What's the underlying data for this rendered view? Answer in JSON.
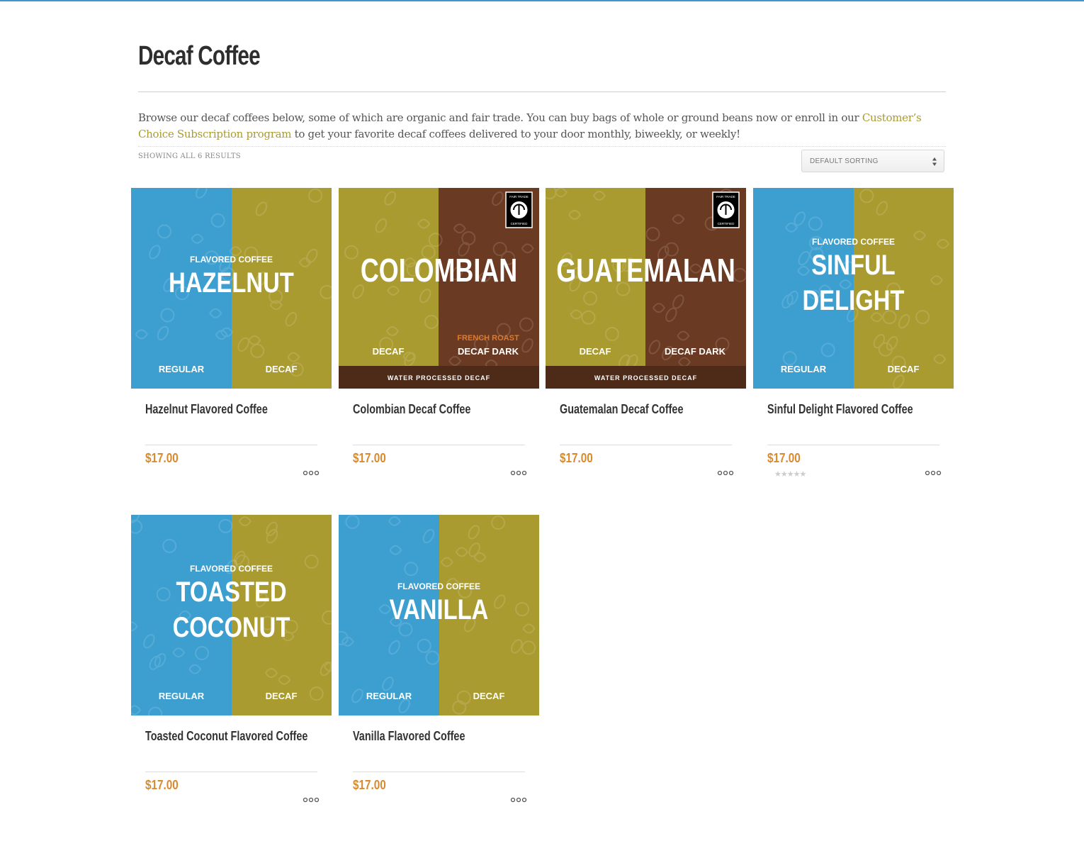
{
  "page": {
    "title": "Decaf Coffee",
    "description_before": "Browse our decaf coffees below, some of which are organic and fair trade. You can buy bags of whole or ground beans now or enroll in our ",
    "description_link": "Customer’s Choice Subscription program",
    "description_after": " to get your favorite decaf coffees delivered to your door monthly, biweekly, or weekly!",
    "result_count": "SHOWING ALL 6 RESULTS",
    "sorting": "DEFAULT SORTING"
  },
  "colors": {
    "blue": "#3d9fd0",
    "olive": "#aa9b30",
    "brown": "#6b3a22",
    "dark_brown_band": "#4e2a19",
    "price": "#d98a2e",
    "link": "#aa9b30"
  },
  "products": [
    {
      "name": "Hazelnut Flavored Coffee",
      "price": "$17.00",
      "image": {
        "style": "flavored",
        "kicker": "FLAVORED COFFEE",
        "line1": "HAZELNUT",
        "line2": "",
        "left": "REGULAR",
        "right": "DECAF"
      },
      "rating_stars": false
    },
    {
      "name": "Colombian Decaf Coffee",
      "price": "$17.00",
      "image": {
        "style": "origin",
        "line1": "COLOMBIAN",
        "roast": "FRENCH ROAST",
        "left": "DECAF",
        "right": "DECAF DARK",
        "band": "WATER PROCESSED DECAF",
        "badge_top": "FAIR TRADE",
        "badge_bottom": "CERTIFIED"
      },
      "rating_stars": false
    },
    {
      "name": "Guatemalan Decaf Coffee",
      "price": "$17.00",
      "image": {
        "style": "origin",
        "line1": "GUATEMALAN",
        "roast": "",
        "left": "DECAF",
        "right": "DECAF DARK",
        "band": "WATER PROCESSED DECAF",
        "badge_top": "FAIR TRADE",
        "badge_bottom": "CERTIFIED"
      },
      "rating_stars": false
    },
    {
      "name": "Sinful Delight Flavored Coffee",
      "price": "$17.00",
      "image": {
        "style": "flavored",
        "kicker": "FLAVORED COFFEE",
        "line1": "SINFUL",
        "line2": "DELIGHT",
        "left": "REGULAR",
        "right": "DECAF"
      },
      "rating_stars": true
    },
    {
      "name": "Toasted Coconut Flavored Coffee",
      "price": "$17.00",
      "image": {
        "style": "flavored",
        "kicker": "FLAVORED COFFEE",
        "line1": "TOASTED",
        "line2": "COCONUT",
        "left": "REGULAR",
        "right": "DECAF"
      },
      "rating_stars": false
    },
    {
      "name": "Vanilla Flavored Coffee",
      "price": "$17.00",
      "image": {
        "style": "flavored",
        "kicker": "FLAVORED COFFEE",
        "line1": "VANILLA",
        "line2": "",
        "left": "REGULAR",
        "right": "DECAF"
      },
      "rating_stars": false
    }
  ]
}
